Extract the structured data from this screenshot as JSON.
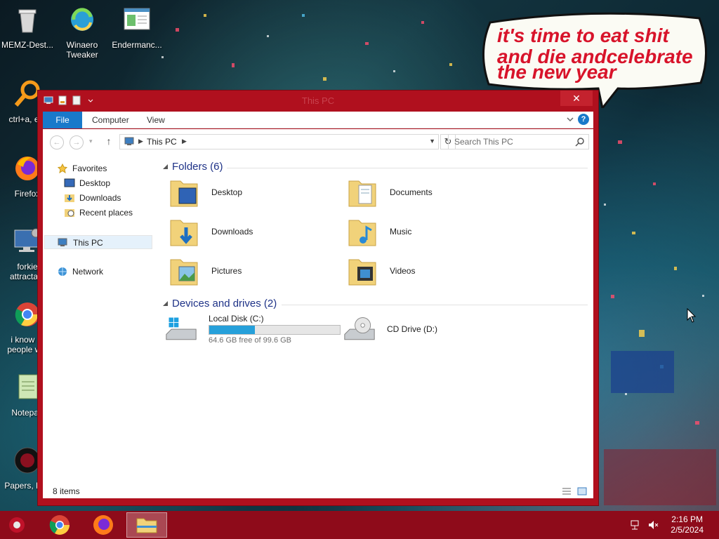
{
  "desktop": {
    "icons": [
      {
        "label": "MEMZ-Dest...",
        "icon": "recycle-bin-icon"
      },
      {
        "label": "Winaero Tweaker",
        "icon": "winaero-icon"
      },
      {
        "label": "Endermanc...",
        "icon": "document-window-icon"
      },
      {
        "label": "ctrl+a, e...",
        "icon": "magnifier-icon"
      },
      {
        "label": "Firefox",
        "icon": "firefox-icon"
      },
      {
        "label": "forkie attracta...",
        "icon": "monitor-gear-icon"
      },
      {
        "label": "i know ... people w...",
        "icon": "chrome-icon"
      },
      {
        "label": "Notepad",
        "icon": "notepad-icon"
      },
      {
        "label": "Papers, Pl...",
        "icon": "papers-please-icon"
      }
    ],
    "bubble_line1": "it's time to eat shit",
    "bubble_line2": "and die andcelebrate",
    "bubble_line3": "the new year"
  },
  "window": {
    "title": "This PC",
    "close_label": "✕",
    "ribbon": {
      "file": "File",
      "computer": "Computer",
      "view": "View",
      "help": "?"
    },
    "address": {
      "crumb": "This PC",
      "search_placeholder": "Search This PC"
    },
    "nav": {
      "favorites": "Favorites",
      "desktop": "Desktop",
      "downloads": "Downloads",
      "recent": "Recent places",
      "thispc": "This PC",
      "network": "Network"
    },
    "folders_header": "Folders (6)",
    "folders": [
      {
        "name": "Desktop",
        "icon": "desktop-folder-icon"
      },
      {
        "name": "Documents",
        "icon": "documents-folder-icon"
      },
      {
        "name": "Downloads",
        "icon": "downloads-folder-icon"
      },
      {
        "name": "Music",
        "icon": "music-folder-icon"
      },
      {
        "name": "Pictures",
        "icon": "pictures-folder-icon"
      },
      {
        "name": "Videos",
        "icon": "videos-folder-icon"
      }
    ],
    "drives_header": "Devices and drives (2)",
    "drives": [
      {
        "name": "Local Disk (C:)",
        "free_text": "64.6 GB free of 99.6 GB",
        "used_fraction": 0.35,
        "icon": "windows-drive-icon"
      },
      {
        "name": "CD Drive (D:)",
        "icon": "cd-drive-icon"
      }
    ],
    "status": "8 items",
    "colors": {
      "accent": "#1979ca",
      "frame": "#b0101e",
      "drive_bar": "#26a0da",
      "group_title": "#1e3287"
    }
  },
  "taskbar": {
    "time": "2:16 PM",
    "date": "2/5/2024",
    "color": "#8e0b1a",
    "apps": [
      "chrome-icon",
      "firefox-icon",
      "file-explorer-icon"
    ]
  }
}
